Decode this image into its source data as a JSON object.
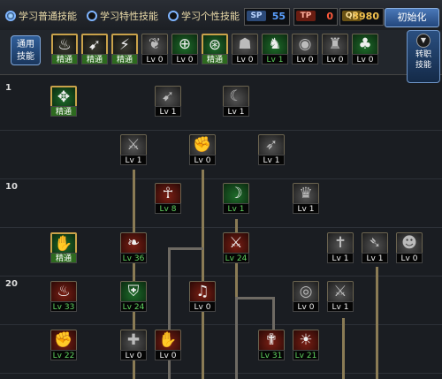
{
  "header": {
    "tabs": [
      {
        "label": "学习普通技能",
        "selected": true
      },
      {
        "label": "学习特性技能",
        "selected": false
      },
      {
        "label": "学习个性技能",
        "selected": false
      }
    ],
    "counters": [
      {
        "icon_text": "SP",
        "value": "55",
        "color": "#5aa0ff"
      },
      {
        "icon_text": "TP",
        "value": "0",
        "color": "#ff5a3c"
      },
      {
        "icon_text": "QP",
        "value": "3980",
        "color": "#f2c14e"
      }
    ],
    "reset_button": "初始化"
  },
  "quickbar": {
    "label_line1": "通用",
    "label_line2": "技能",
    "skills": [
      {
        "icon": "sit-icon",
        "glyph": "♨",
        "level": "精通",
        "tier": "gold"
      },
      {
        "icon": "run-icon",
        "glyph": "➹",
        "level": "精通",
        "tier": "gold"
      },
      {
        "icon": "leap-icon",
        "glyph": "⚡",
        "level": "精通",
        "tier": "gold"
      },
      {
        "icon": "wings-icon",
        "glyph": "❦",
        "level": "Lv 0",
        "tier": "gray"
      },
      {
        "icon": "target-icon",
        "glyph": "⊕",
        "level": "Lv 0",
        "tier": "green"
      },
      {
        "icon": "crosshair-icon",
        "glyph": "⊛",
        "level": "精通",
        "tier": "green"
      },
      {
        "icon": "figure-icon",
        "glyph": "☗",
        "level": "Lv 0",
        "tier": "gray"
      },
      {
        "icon": "creature-icon",
        "glyph": "♞",
        "level": "Lv 1",
        "tier": "green"
      },
      {
        "icon": "eye-icon",
        "glyph": "◉",
        "level": "Lv 0",
        "tier": "gray"
      },
      {
        "icon": "warrior-icon",
        "glyph": "♜",
        "level": "Lv 0",
        "tier": "gray"
      },
      {
        "icon": "tree-icon",
        "glyph": "♣",
        "level": "Lv 0",
        "tier": "green"
      }
    ],
    "side_label_line1": "转职",
    "side_label_line2": "技能"
  },
  "rows": [
    "1",
    "10",
    "20"
  ],
  "tree": [
    {
      "name": "skill-claw-strike",
      "glyph": "✥",
      "level": "精通",
      "tier": "green"
    },
    {
      "name": "skill-dash",
      "glyph": "➹",
      "level": "Lv 1",
      "tier": "gray"
    },
    {
      "name": "skill-slash",
      "glyph": "☾",
      "level": "Lv 1",
      "tier": "gray"
    },
    {
      "name": "skill-sword-burst",
      "glyph": "⚔",
      "level": "Lv 1",
      "tier": "gray"
    },
    {
      "name": "skill-grab",
      "glyph": "✊",
      "level": "Lv 0",
      "tier": "gray"
    },
    {
      "name": "skill-whirl",
      "glyph": "➶",
      "level": "Lv 1",
      "tier": "gray"
    },
    {
      "name": "skill-ankh",
      "glyph": "☥",
      "level": "Lv 8",
      "tier": "red"
    },
    {
      "name": "skill-shadow",
      "glyph": "☽",
      "level": "Lv 1",
      "tier": "green"
    },
    {
      "name": "skill-helm",
      "glyph": "♛",
      "level": "Lv 1",
      "tier": "gray"
    },
    {
      "name": "skill-palm",
      "glyph": "✋",
      "level": "精通",
      "tier": "green"
    },
    {
      "name": "skill-phoenix",
      "glyph": "❧",
      "level": "Lv 36",
      "tier": "red"
    },
    {
      "name": "skill-crossed-swords",
      "glyph": "⚔",
      "level": "Lv 24",
      "tier": "red"
    },
    {
      "name": "skill-holy-cross",
      "glyph": "✝",
      "level": "Lv 1",
      "tier": "gray"
    },
    {
      "name": "skill-bow",
      "glyph": "➴",
      "level": "Lv 1",
      "tier": "gray"
    },
    {
      "name": "skill-mask",
      "glyph": "☻",
      "level": "Lv 0",
      "tier": "gray"
    },
    {
      "name": "skill-flame",
      "glyph": "♨",
      "level": "Lv 33",
      "tier": "red"
    },
    {
      "name": "skill-shield",
      "glyph": "⛨",
      "level": "Lv 24",
      "tier": "green"
    },
    {
      "name": "skill-music",
      "glyph": "♫",
      "level": "Lv 0",
      "tier": "red"
    },
    {
      "name": "skill-vortex",
      "glyph": "◎",
      "level": "Lv 0",
      "tier": "gray"
    },
    {
      "name": "skill-blade-rain",
      "glyph": "⚔",
      "level": "Lv 1",
      "tier": "gray"
    },
    {
      "name": "skill-fire-fist",
      "glyph": "✊",
      "level": "Lv 22",
      "tier": "red"
    },
    {
      "name": "skill-cross-shield",
      "glyph": "✚",
      "level": "Lv 0",
      "tier": "gray"
    },
    {
      "name": "skill-fire-hand",
      "glyph": "✋",
      "level": "Lv 0",
      "tier": "red"
    },
    {
      "name": "skill-divine-light",
      "glyph": "✟",
      "level": "Lv 31",
      "tier": "red"
    },
    {
      "name": "skill-pumpkin",
      "glyph": "☀",
      "level": "Lv 21",
      "tier": "red"
    }
  ]
}
